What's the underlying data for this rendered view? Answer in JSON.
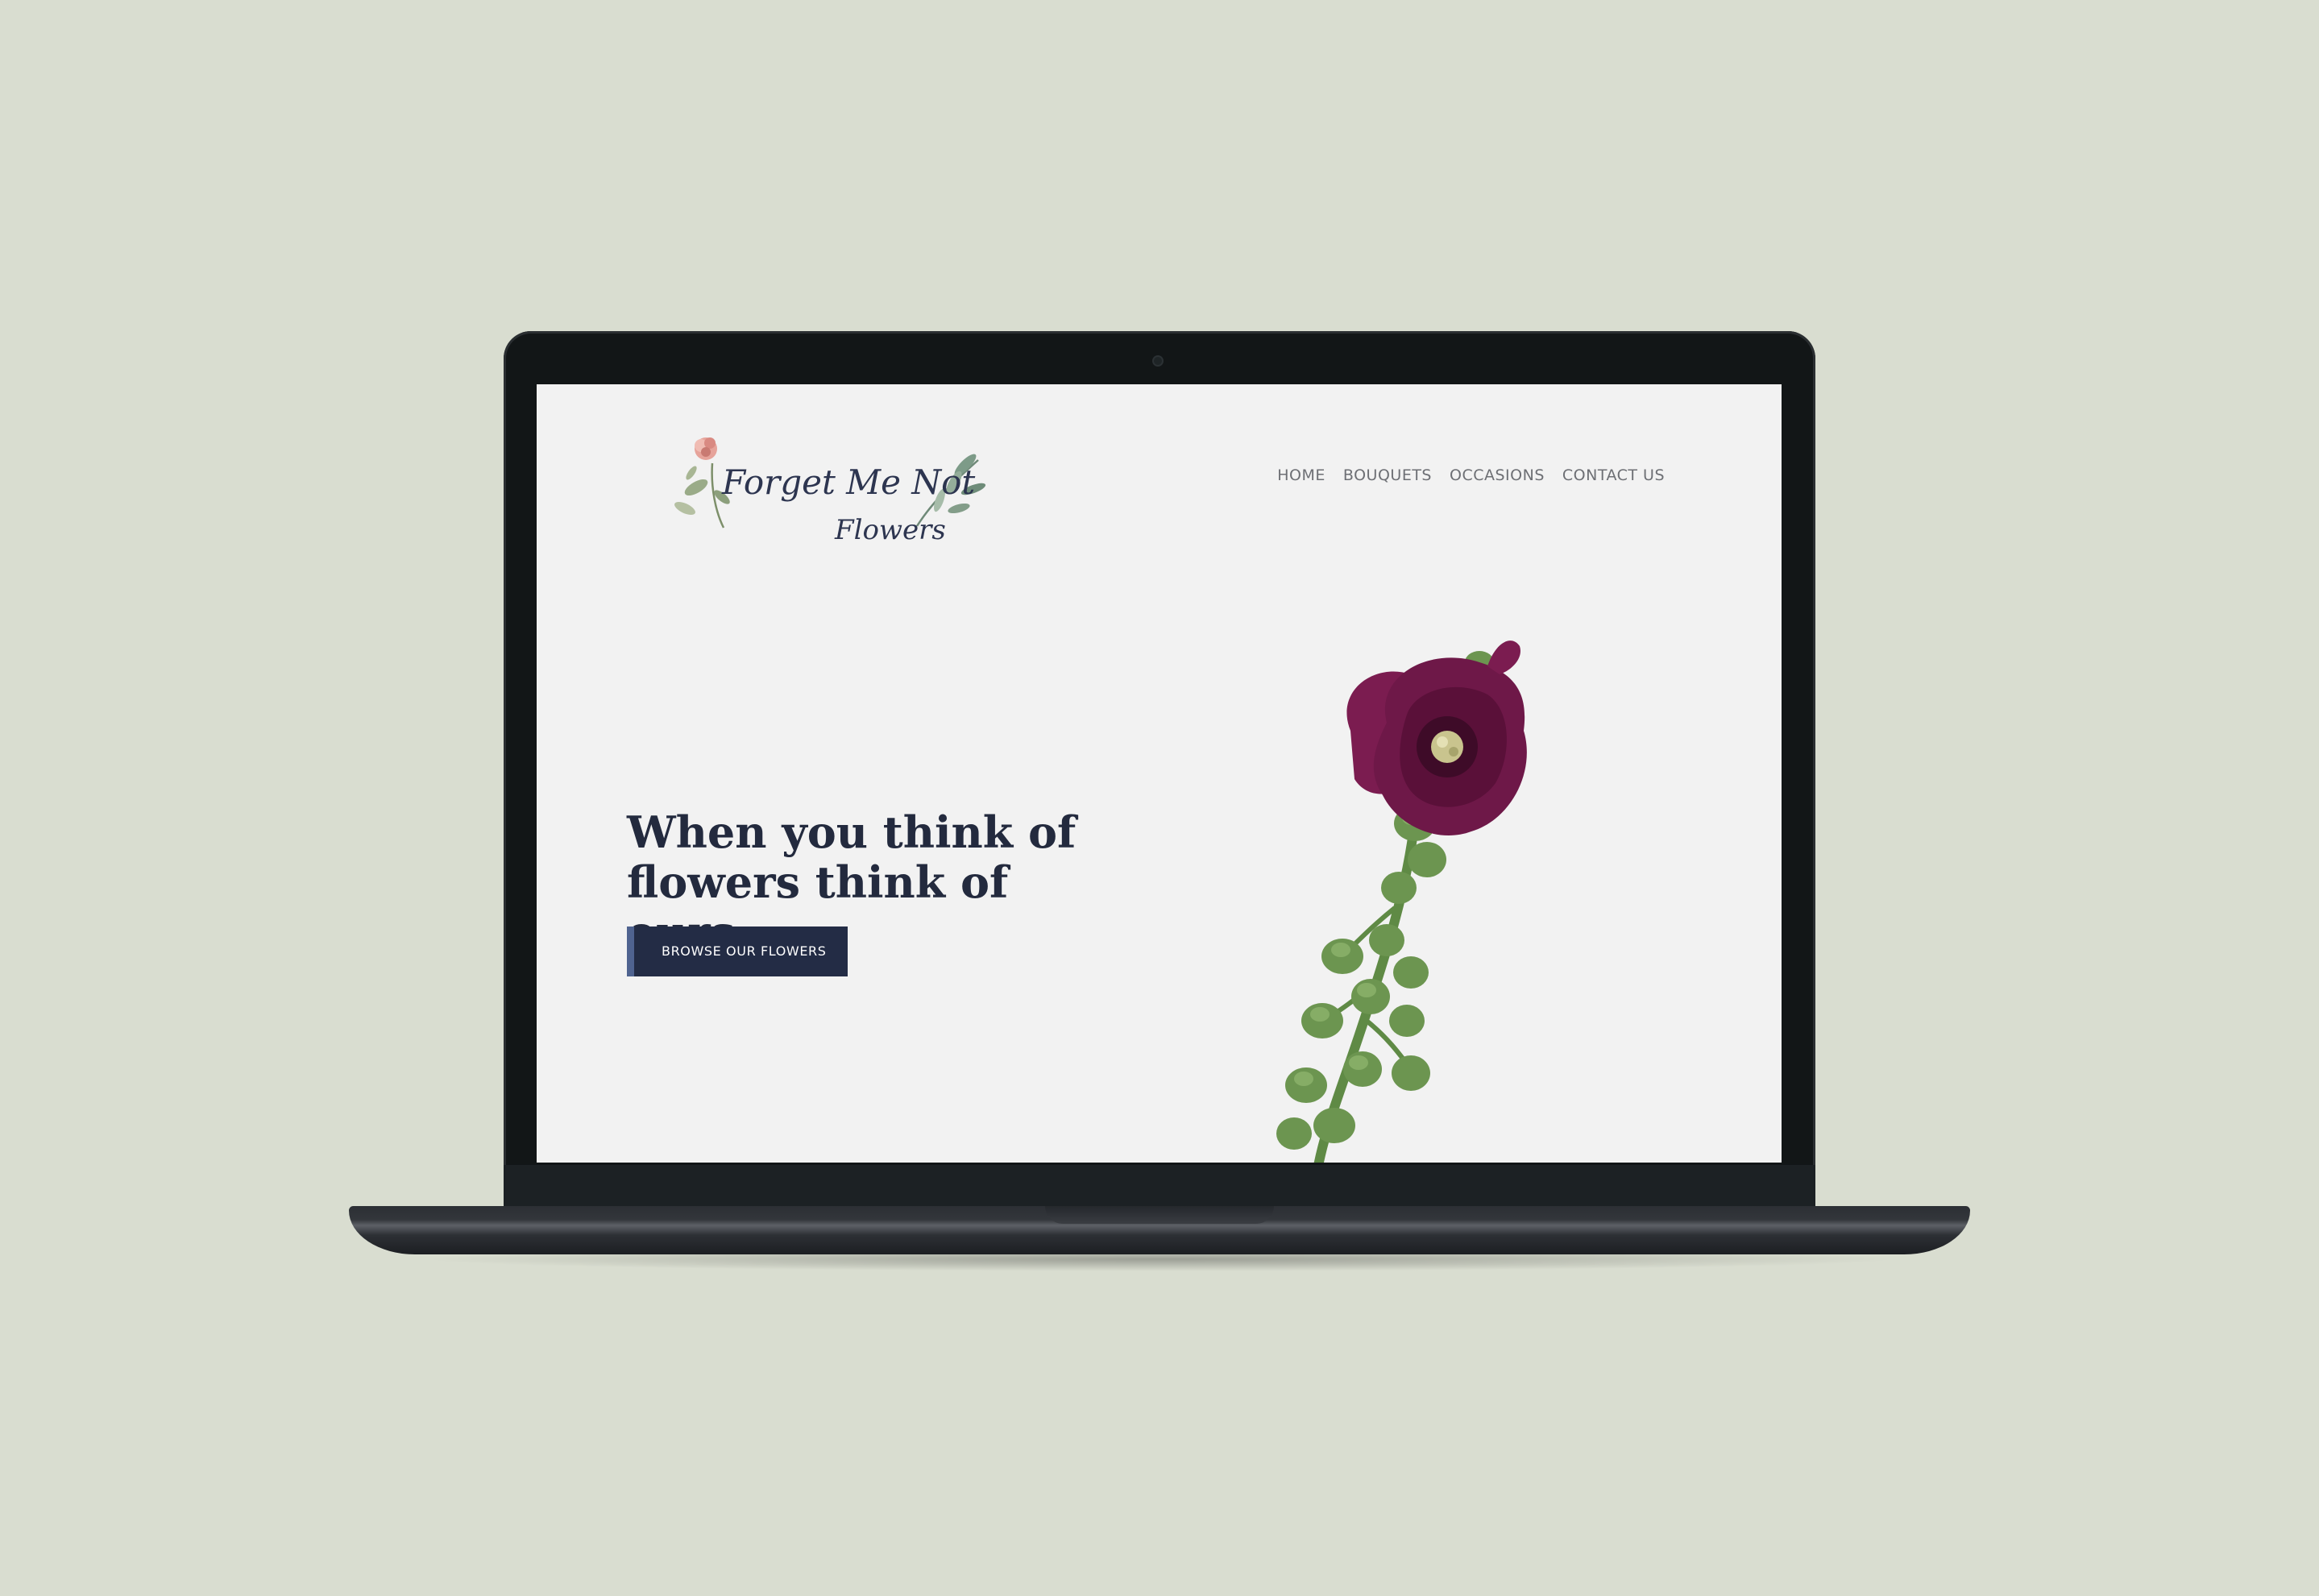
{
  "site": {
    "logo_text_line1": "Forget Me Not",
    "logo_text_line2": "Flowers"
  },
  "nav": {
    "items": [
      {
        "label": "HOME"
      },
      {
        "label": "BOUQUETS"
      },
      {
        "label": "OCCASIONS"
      },
      {
        "label": "CONTACT US"
      }
    ]
  },
  "hero": {
    "title_line1": "When you think of",
    "title_line2": "flowers think of ours.",
    "cta_label": "BROWSE OUR FLOWERS"
  },
  "colors": {
    "backdrop": "#d9ddd0",
    "screen_bg": "#f2f2f2",
    "heading": "#232a3e",
    "button_bg": "#232c45",
    "button_accent": "#4f6390",
    "nav_text": "#6d6f74",
    "flower_petal": "#6e1848"
  },
  "icons": {
    "logo_rose": "rose-icon",
    "logo_leaves": "leaf-sprig-icon"
  }
}
